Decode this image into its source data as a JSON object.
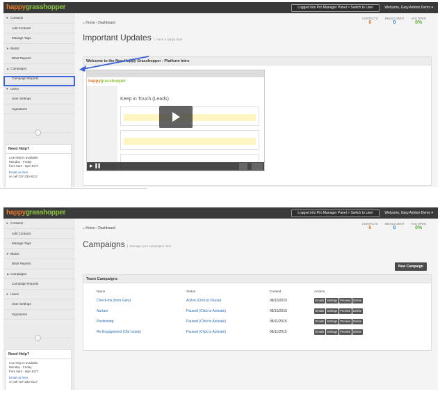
{
  "brand": {
    "part1": "happy",
    "part2": "grasshopper"
  },
  "header": {
    "pro_manager": "Logged into Pro Manager Panel > Switch to User",
    "welcome": "Welcome, Gary Ashton Demo ▾"
  },
  "sidebar": {
    "items": [
      {
        "label": "Contacts",
        "icon": "user-icon"
      },
      {
        "label": "Add Contacts"
      },
      {
        "label": "Manage Tags"
      },
      {
        "label": "Blasts",
        "icon": "send-icon"
      },
      {
        "label": "Blast Reports"
      },
      {
        "label": "Campaigns",
        "icon": "rocket-icon"
      },
      {
        "label": "Campaign Reports"
      },
      {
        "label": "Users",
        "icon": "user-icon"
      },
      {
        "label": "User Settings"
      },
      {
        "label": "Signatures"
      }
    ],
    "collapse": "‹"
  },
  "help": {
    "title": "Need Help?",
    "line1": "Live help is available",
    "line2": "Monday - Friday",
    "line3": "from 9am - 8pm EST.",
    "email": "Email us here",
    "phone": "or call 727-232-9117"
  },
  "stats": {
    "contacts_label": "CONTACTS",
    "contacts": "6",
    "sent_label": "EMAILS SENT",
    "sent": "0",
    "open_label": "AVG OPEN",
    "open": "0%"
  },
  "breadcrumb1": "Home › Dashboard",
  "breadcrumb2": "Home › Dashboard",
  "screen1": {
    "title": "Important Updates",
    "subtitle": "Have a happy day!",
    "panel_title": "Welcome to the New Happy Grasshopper - Platform Intro",
    "video": {
      "inner_title": "Keep in Touch (Leads)",
      "controls": "▶ ▐▐"
    }
  },
  "screen2": {
    "title": "Campaigns",
    "subtitle": "Manage your campaigns here.",
    "new_button": "New Campaign",
    "panel_title": "Team Campaigns",
    "columns": [
      "Name",
      "Status",
      "Created",
      "Actions"
    ],
    "rows": [
      {
        "name": "Check-ins (from Gary)",
        "status": "Active",
        "status_action": "(Click to Pause)",
        "created": "08/10/2015"
      },
      {
        "name": "Nurture",
        "status": "Paused",
        "status_action": "(Click to Activate)",
        "created": "08/10/2015"
      },
      {
        "name": "Positioning",
        "status": "Paused",
        "status_action": "(Click to Activate)",
        "created": "08/11/2015"
      },
      {
        "name": "Re-Engagement (Old Leads)",
        "status": "Paused",
        "status_action": "(Click to Activate)",
        "created": "08/11/2015"
      }
    ],
    "actions": [
      "Emails",
      "Settings",
      "Preview",
      "Delete"
    ]
  },
  "colors": {
    "accent_orange": "#e8792b",
    "accent_green": "#8dc63f",
    "link": "#2a6bb3",
    "highlight": "#3d63d8"
  }
}
